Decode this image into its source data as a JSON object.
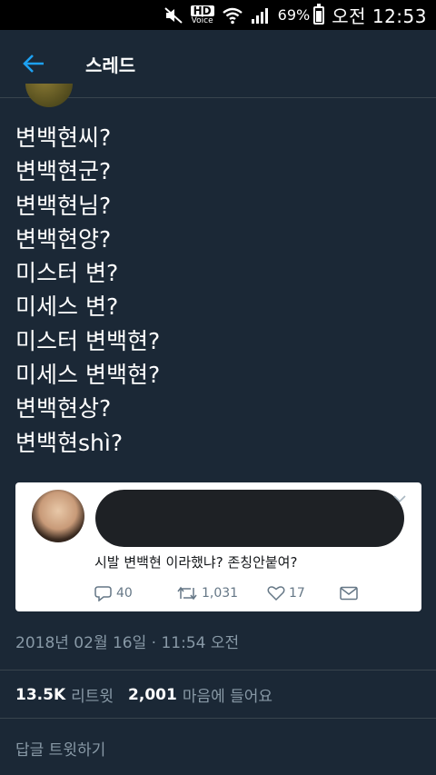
{
  "status_bar": {
    "hd_label": "HD",
    "voice_label": "Voice",
    "battery_percent": "69%",
    "battery_level": 0.69,
    "clock": "오전 12:53"
  },
  "header": {
    "title": "스레드"
  },
  "tweet": {
    "lines": [
      "변백현씨?",
      "변백현군?",
      "변백현님?",
      "변백현양?",
      "미스터 변?",
      "미세스 변?",
      "미스터 변백현?",
      "미세스 변백현?",
      "변백현상?",
      "변백현shì?"
    ],
    "timestamp": "2018년 02월 16일 · 11:54 오전",
    "retweets_count": "13.5K",
    "retweets_label": "리트윗",
    "likes_count": "2,001",
    "likes_label": "마음에 들어요"
  },
  "embedded_card": {
    "text": "시발 변백현 이라했냐? 존칭안붙여?",
    "reply_count": "40",
    "retweet_count": "1,031",
    "like_count": "17"
  },
  "reply_box": {
    "placeholder": "답글 트윗하기"
  },
  "colors": {
    "background": "#1b2836",
    "accent": "#1da1f2",
    "muted": "#8899a6",
    "divider": "#38444d"
  }
}
